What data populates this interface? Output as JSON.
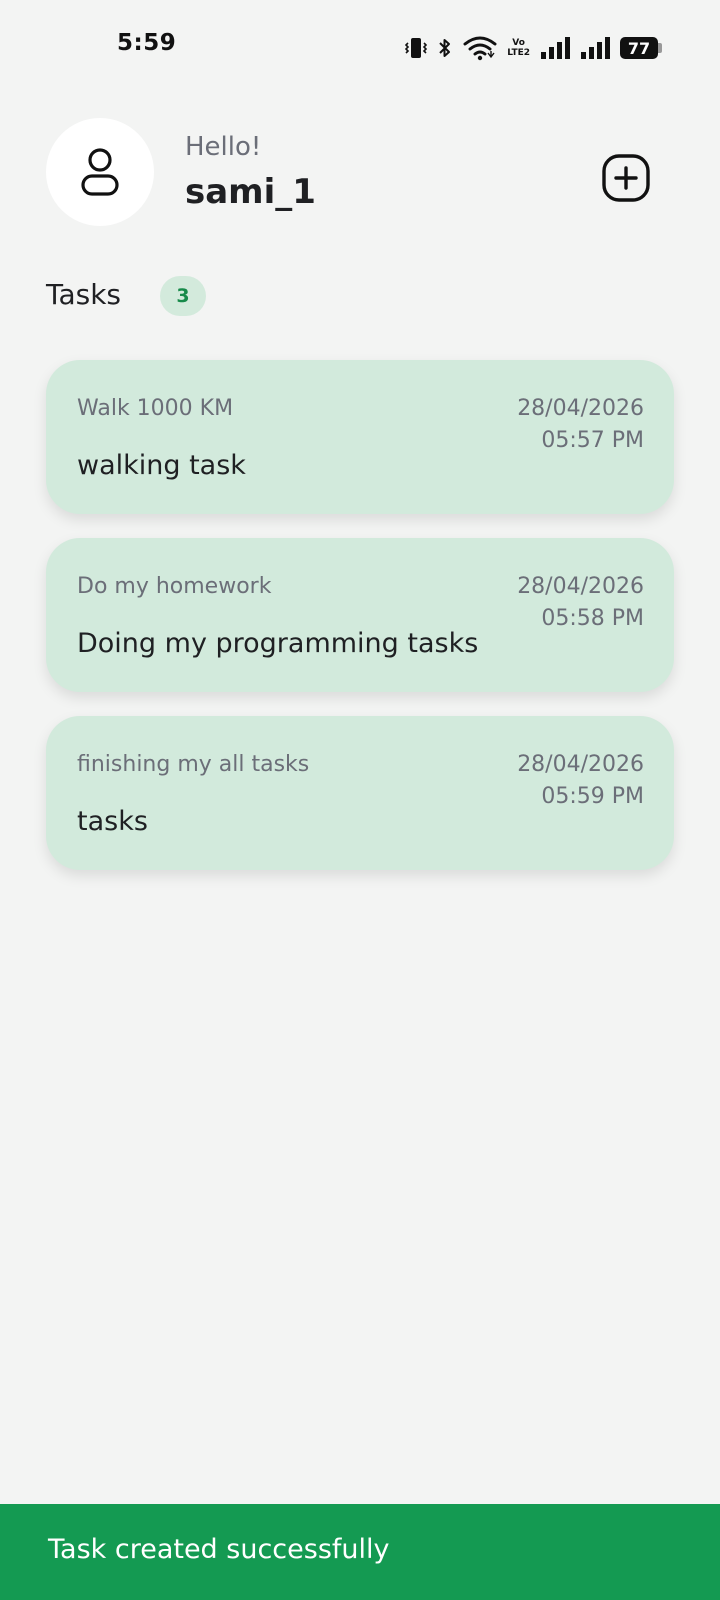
{
  "status_bar": {
    "time": "5:59",
    "lte_top": "Vo",
    "lte_bottom": "LTE2",
    "battery": "77",
    "icons": [
      "vibrate-icon",
      "bluetooth-icon",
      "wifi-icon",
      "volte-icon",
      "signal-icon",
      "signal-icon",
      "battery-icon"
    ]
  },
  "header": {
    "greeting": "Hello!",
    "username": "sami_1",
    "avatar_icon": "person-icon",
    "add_icon": "add-square-icon"
  },
  "tasks": {
    "heading": "Tasks",
    "count": "3",
    "items": [
      {
        "title": "Walk 1000 KM",
        "description": "walking task",
        "date": "28/04/2026",
        "time": "05:57 PM"
      },
      {
        "title": "Do my homework",
        "description": "Doing my programming tasks",
        "date": "28/04/2026",
        "time": "05:58 PM"
      },
      {
        "title": "finishing my all tasks",
        "description": "tasks",
        "date": "28/04/2026",
        "time": "05:59 PM"
      }
    ]
  },
  "snackbar": {
    "message": "Task created successfully"
  },
  "colors": {
    "background": "#f3f4f3",
    "card": "#d2eadc",
    "badge_bg": "#d3eadc",
    "badge_text": "#178a4a",
    "snackbar": "#149a52"
  }
}
